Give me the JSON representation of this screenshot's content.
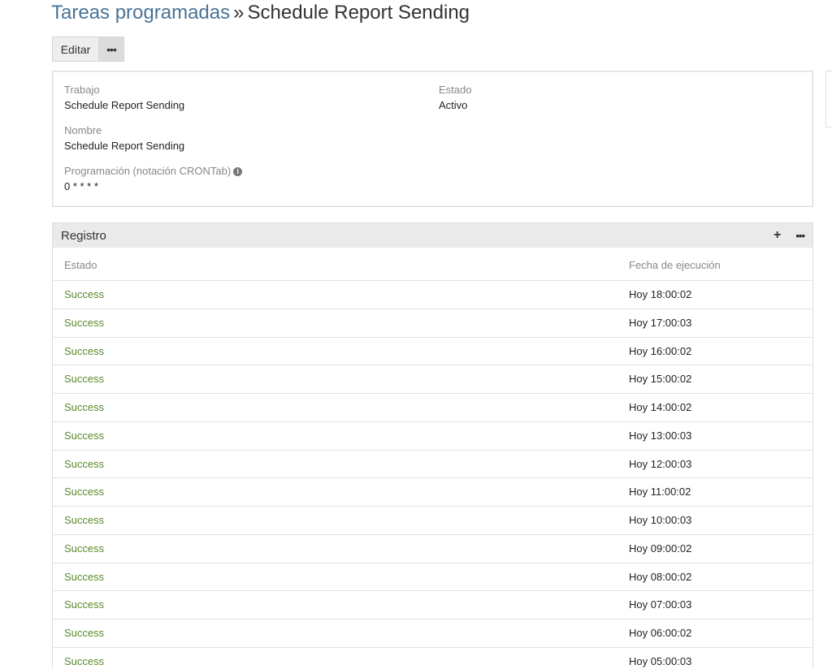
{
  "header": {
    "breadcrumb_link": "Tareas programadas",
    "separator": "»",
    "current": "Schedule Report Sending"
  },
  "toolbar": {
    "edit_label": "Editar",
    "more_label": "•••"
  },
  "detail": {
    "job_label": "Trabajo",
    "job_value": "Schedule Report Sending",
    "status_label": "Estado",
    "status_value": "Activo",
    "name_label": "Nombre",
    "name_value": "Schedule Report Sending",
    "schedule_label": "Programación (notación CRONTab)",
    "schedule_icon": "i",
    "schedule_value": "0 * * * *"
  },
  "log": {
    "title": "Registro",
    "add_label": "+",
    "more_label": "•••",
    "columns": {
      "status": "Estado",
      "date": "Fecha de ejecución"
    },
    "rows": [
      {
        "status": "Success",
        "date": "Hoy 18:00:02"
      },
      {
        "status": "Success",
        "date": "Hoy 17:00:03"
      },
      {
        "status": "Success",
        "date": "Hoy 16:00:02"
      },
      {
        "status": "Success",
        "date": "Hoy 15:00:02"
      },
      {
        "status": "Success",
        "date": "Hoy 14:00:02"
      },
      {
        "status": "Success",
        "date": "Hoy 13:00:03"
      },
      {
        "status": "Success",
        "date": "Hoy 12:00:03"
      },
      {
        "status": "Success",
        "date": "Hoy 11:00:02"
      },
      {
        "status": "Success",
        "date": "Hoy 10:00:03"
      },
      {
        "status": "Success",
        "date": "Hoy 09:00:02"
      },
      {
        "status": "Success",
        "date": "Hoy 08:00:02"
      },
      {
        "status": "Success",
        "date": "Hoy 07:00:03"
      },
      {
        "status": "Success",
        "date": "Hoy 06:00:02"
      },
      {
        "status": "Success",
        "date": "Hoy 05:00:03"
      }
    ]
  },
  "colors": {
    "link": "#4a7396",
    "success": "#5a8a2a",
    "header_bg": "#eaeaea"
  }
}
